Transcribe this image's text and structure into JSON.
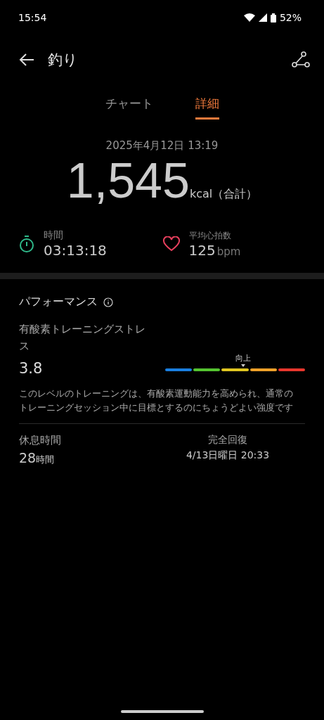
{
  "status_bar": {
    "time": "15:54",
    "battery": "52%"
  },
  "header": {
    "title": "釣り"
  },
  "tabs": [
    {
      "label": "チャート",
      "selected": false
    },
    {
      "label": "詳細",
      "selected": true
    }
  ],
  "summary": {
    "date": "2025年4月12日 13:19",
    "calories": "1,545",
    "unit": "kcal（合計）"
  },
  "stats": [
    {
      "kind": "timer",
      "label": "時間",
      "value": "03:13:18"
    },
    {
      "kind": "heart",
      "label": "平均心拍数",
      "value": "125",
      "unit": "bpm"
    }
  ],
  "performance": {
    "title": "パフォーマンス",
    "metric": {
      "label": "有酸素トレーニングストレス",
      "value": "3.8",
      "marker_label": "向上",
      "level": 0.56,
      "description": "このレベルのトレーニングは、有酸素運動能力を高められ、通常のトレーニングセッション中に目標とするのにちょうどよい強度です"
    },
    "rest": {
      "label": "休息時間",
      "value": "28",
      "unit": "時間",
      "recovery_label": "完全回復",
      "recovery_time": "4/13日曜日 20:33"
    }
  }
}
